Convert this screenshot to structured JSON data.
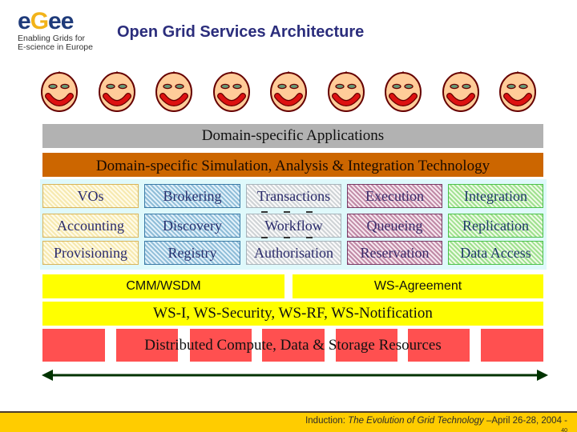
{
  "logo": {
    "wordmark_parts": [
      "e",
      "G",
      "ee"
    ],
    "tagline_line1": "Enabling Grids for",
    "tagline_line2": "E-science in Europe"
  },
  "title": "Open Grid Services Architecture",
  "users": {
    "count": 9,
    "icon": "smiley-face-icon"
  },
  "layers": {
    "applications": "Domain-specific Applications",
    "simulation": "Domain-specific Simulation, Analysis & Integration Technology",
    "services": [
      [
        "VOs",
        "Brokering",
        "Transactions",
        "Execution",
        "Integration"
      ],
      [
        "Accounting",
        "Discovery",
        "Workflow",
        "Queueing",
        "Replication"
      ],
      [
        "Provisioning",
        "Registry",
        "Authorisation",
        "Reservation",
        "Data Access"
      ]
    ],
    "management": "CMM/WSDM",
    "agreement": "WS-Agreement",
    "standards": "WS-I, WS-Security, WS-RF, WS-Notification",
    "resources": "Distributed Compute, Data & Storage Resources"
  },
  "footer": {
    "prefix": "Induction: ",
    "italic": "The Evolution of Grid Technology",
    "suffix": " –April 26-28, 2004  -",
    "page": "40"
  },
  "colors": {
    "title": "#2b2d7c",
    "applications": "#b2b2b2",
    "simulation": "#cc6600",
    "yellow_layer": "#ffff00",
    "resources": "#ff5050",
    "footer": "#ffcc00",
    "arrow": "#003300"
  }
}
